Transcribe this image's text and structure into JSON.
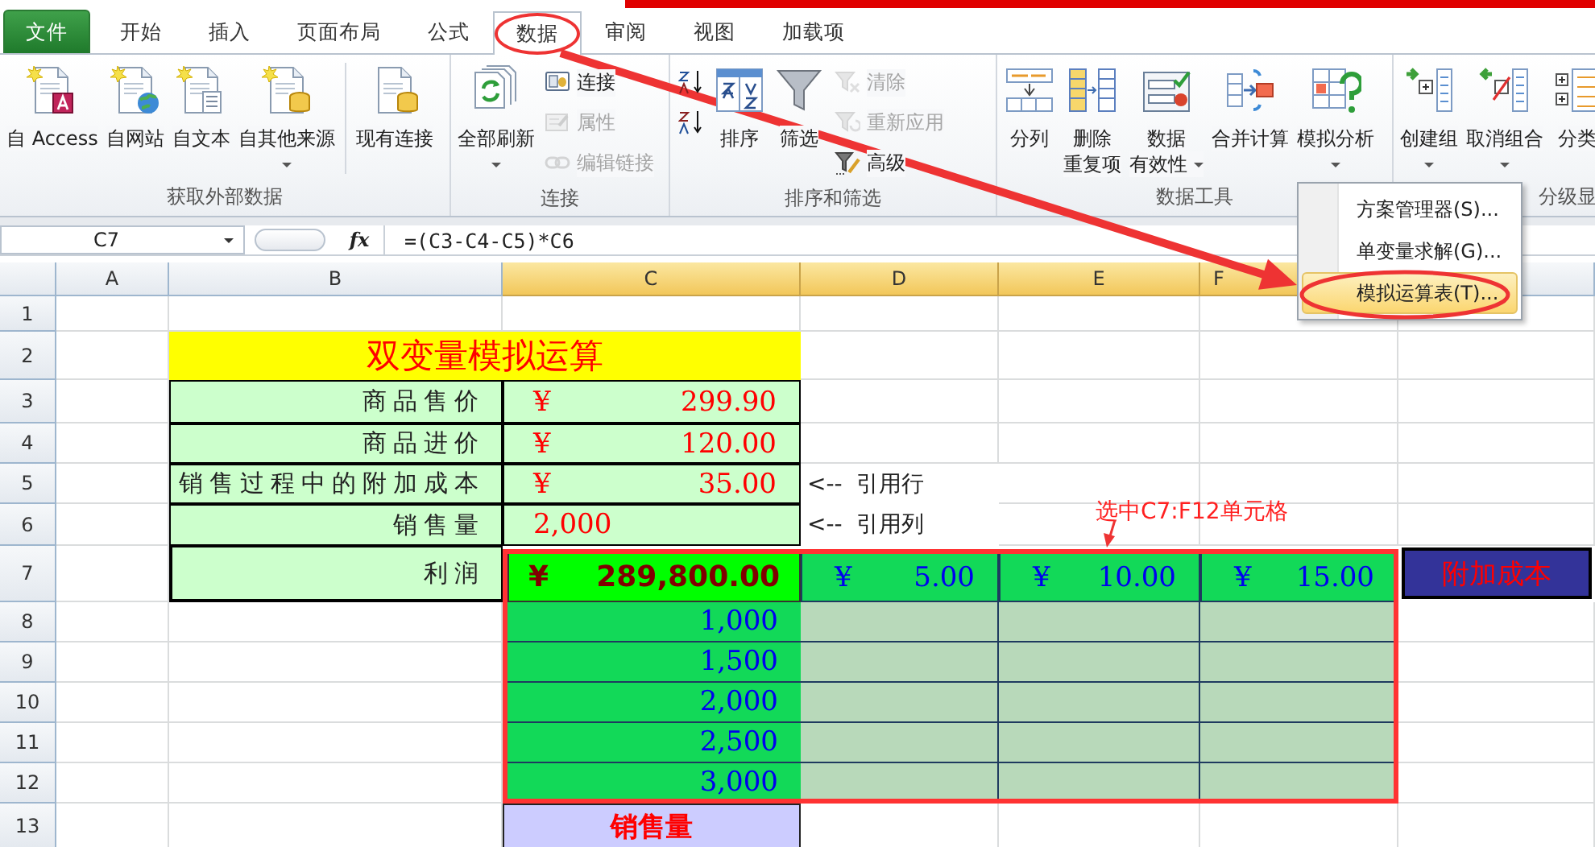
{
  "tabs": [
    {
      "label": "文件",
      "kind": "file",
      "selected": false
    },
    {
      "label": "开始",
      "kind": "tab",
      "selected": false
    },
    {
      "label": "插入",
      "kind": "tab",
      "selected": false
    },
    {
      "label": "页面布局",
      "kind": "tab",
      "selected": false
    },
    {
      "label": "公式",
      "kind": "tab",
      "selected": false
    },
    {
      "label": "数据",
      "kind": "tab",
      "selected": true
    },
    {
      "label": "审阅",
      "kind": "tab",
      "selected": false
    },
    {
      "label": "视图",
      "kind": "tab",
      "selected": false
    },
    {
      "label": "加载项",
      "kind": "tab",
      "selected": false
    }
  ],
  "ribbon": {
    "groups": [
      {
        "label": "获取外部数据",
        "items": [
          {
            "kind": "large",
            "lines": [
              "自 Access"
            ]
          },
          {
            "kind": "large",
            "lines": [
              "自网站"
            ]
          },
          {
            "kind": "large",
            "lines": [
              "自文本"
            ]
          },
          {
            "kind": "large",
            "lines": [
              "自其他来源"
            ],
            "dropdown": true
          },
          {
            "kind": "separator"
          },
          {
            "kind": "large",
            "lines": [
              "现有连接"
            ]
          }
        ]
      },
      {
        "label": "连接",
        "items": [
          {
            "kind": "large",
            "lines": [
              "全部刷新"
            ],
            "dropdown": true
          },
          {
            "kind": "stack",
            "items": [
              {
                "label": "连接",
                "disabled": false
              },
              {
                "label": "属性",
                "disabled": true
              },
              {
                "label": "编辑链接",
                "disabled": true
              }
            ]
          }
        ]
      },
      {
        "label": "排序和筛选",
        "items": [
          {
            "kind": "stack",
            "items": [
              {
                "disabled": false
              },
              {
                "disabled": false
              }
            ]
          },
          {
            "kind": "large",
            "lines": [
              "排序"
            ]
          },
          {
            "kind": "large",
            "lines": [
              "筛选"
            ]
          },
          {
            "kind": "stack",
            "items": [
              {
                "label": "清除",
                "disabled": true
              },
              {
                "label": "重新应用",
                "disabled": true
              },
              {
                "label": "高级",
                "disabled": false
              }
            ]
          }
        ]
      },
      {
        "label": "数据工具",
        "items": [
          {
            "kind": "large",
            "lines": [
              "分列"
            ]
          },
          {
            "kind": "large",
            "lines": [
              "删除",
              "重复项"
            ]
          },
          {
            "kind": "large",
            "lines": [
              "数据",
              "有效性"
            ],
            "dropdown": true
          },
          {
            "kind": "large",
            "lines": [
              "合并计算"
            ]
          },
          {
            "kind": "large",
            "lines": [
              "模拟分析"
            ],
            "dropdown": true
          }
        ]
      },
      {
        "label": "分级显",
        "items": [
          {
            "kind": "large",
            "lines": [
              "创建组"
            ],
            "dropdown": true
          },
          {
            "kind": "large",
            "lines": [
              "取消组合"
            ],
            "dropdown": true
          },
          {
            "kind": "large",
            "lines": [
              "分类"
            ]
          }
        ]
      }
    ]
  },
  "formula_bar": {
    "name_box": "C7",
    "fx": "fx",
    "formula": "=(C3-C4-C5)*C6"
  },
  "sheet": {
    "columns": [
      {
        "label": "A",
        "selected": false
      },
      {
        "label": "B",
        "selected": false
      },
      {
        "label": "C",
        "selected": true
      },
      {
        "label": "D",
        "selected": true
      },
      {
        "label": "E",
        "selected": true
      },
      {
        "label": "F",
        "selected": true
      }
    ],
    "rows": [
      "1",
      "2",
      "3",
      "4",
      "5",
      "6",
      "7",
      "8",
      "9",
      "10",
      "11",
      "12",
      "13"
    ],
    "title": "双变量模拟运算",
    "inputs": [
      {
        "label": "商品售价",
        "currency": "¥",
        "value": "299.90"
      },
      {
        "label": "商品进价",
        "currency": "¥",
        "value": "120.00"
      },
      {
        "label": "销售过程中的附加成本",
        "currency": "¥",
        "value": "35.00"
      },
      {
        "label": "销售量",
        "value": "2,000"
      }
    ],
    "profit": {
      "label": "利润",
      "currency": "¥",
      "value": "289,800.00"
    },
    "row_inputs": [
      {
        "currency": "¥",
        "value": "5.00"
      },
      {
        "currency": "¥",
        "value": "10.00"
      },
      {
        "currency": "¥",
        "value": "15.00"
      }
    ],
    "column_inputs": [
      "1,000",
      "1,500",
      "2,000",
      "2,500",
      "3,000"
    ],
    "notes": [
      "<--  引用行",
      "<--  引用列"
    ],
    "selection_note": "选中C7:F12单元格",
    "row_axis_label": "附加成本",
    "column_axis_label": "销售量"
  },
  "menu": {
    "items": [
      {
        "label": "方案管理器(S)...",
        "selected": false
      },
      {
        "label": "单变量求解(G)...",
        "selected": false
      },
      {
        "label": "模拟运算表(T)...",
        "selected": true
      }
    ]
  }
}
